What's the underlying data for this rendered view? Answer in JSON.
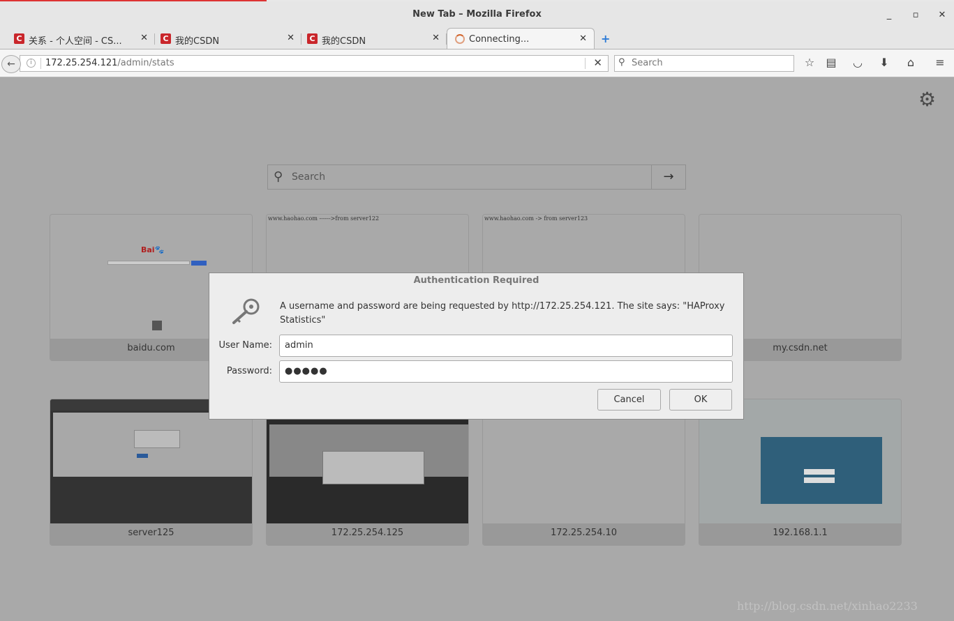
{
  "window": {
    "title": "New Tab – Mozilla Firefox"
  },
  "tabs": [
    {
      "label": "关系 - 个人空间 - CS...",
      "favicon": "csdn-icon"
    },
    {
      "label": "我的CSDN",
      "favicon": "csdn-icon"
    },
    {
      "label": "我的CSDN",
      "favicon": "csdn-icon"
    },
    {
      "label": "Connecting...",
      "favicon": "loading-spinner"
    }
  ],
  "navbar": {
    "url_host": "172.25.254.121",
    "url_path": "/admin/stats",
    "search_placeholder": "Search"
  },
  "newtab": {
    "search_placeholder": "Search",
    "tiles": [
      {
        "caption": "baidu.com",
        "thumb_text": ""
      },
      {
        "caption": "",
        "thumb_text": "www.haohao.com ------>from server122"
      },
      {
        "caption": "",
        "thumb_text": "www.haohao.com -> from server123"
      },
      {
        "caption": "my.csdn.net",
        "thumb_text": ""
      },
      {
        "caption": "server125",
        "thumb_text": ""
      },
      {
        "caption": "172.25.254.125",
        "thumb_text": ""
      },
      {
        "caption": "172.25.254.10",
        "thumb_text": ""
      },
      {
        "caption": "192.168.1.1",
        "thumb_text": ""
      }
    ]
  },
  "dialog": {
    "title": "Authentication Required",
    "message": "A username and password are being requested by http://172.25.254.121. The site says: \"HAProxy Statistics\"",
    "username_label": "User Name:",
    "username_value": "admin",
    "password_label": "Password:",
    "password_value": "●●●●●",
    "cancel_label": "Cancel",
    "ok_label": "OK"
  },
  "watermark": "http://blog.csdn.net/xinhao2233",
  "colors": {
    "csdn_red": "#c9262b",
    "accent_blue": "#2d7bd6"
  }
}
